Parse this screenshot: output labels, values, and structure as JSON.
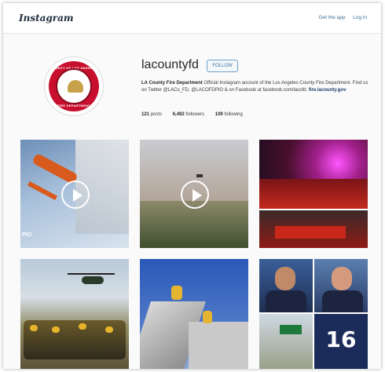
{
  "header": {
    "logo": "Instagram",
    "nav": [
      "Get the app",
      "Log in"
    ]
  },
  "profile": {
    "username": "lacountyfd",
    "follow_label": "FOLLOW",
    "bio_name": "LA County Fire Department",
    "bio_text": " Official Instagram account of the Los Angeles County Fire Department. Find us on Twitter @LACo_FD, @LACOFDPIO & on Facebook at facebook.com/lacofd. ",
    "bio_link": "fire.lacounty.gov",
    "stats": {
      "posts_count": "121",
      "posts_label": "posts",
      "followers_count": "6,492",
      "followers_label": "followers",
      "following_count": "109",
      "following_label": "following"
    },
    "seal_top_text": "COUNTY OF LOS ANGELES",
    "seal_bottom_text": "FIRE DEPARTMENT"
  },
  "grid": {
    "tile1_tag": "PIO",
    "tile6_badge": "16"
  },
  "colors": {
    "link_blue": "#3f729b",
    "seal_red": "#c8102e"
  }
}
